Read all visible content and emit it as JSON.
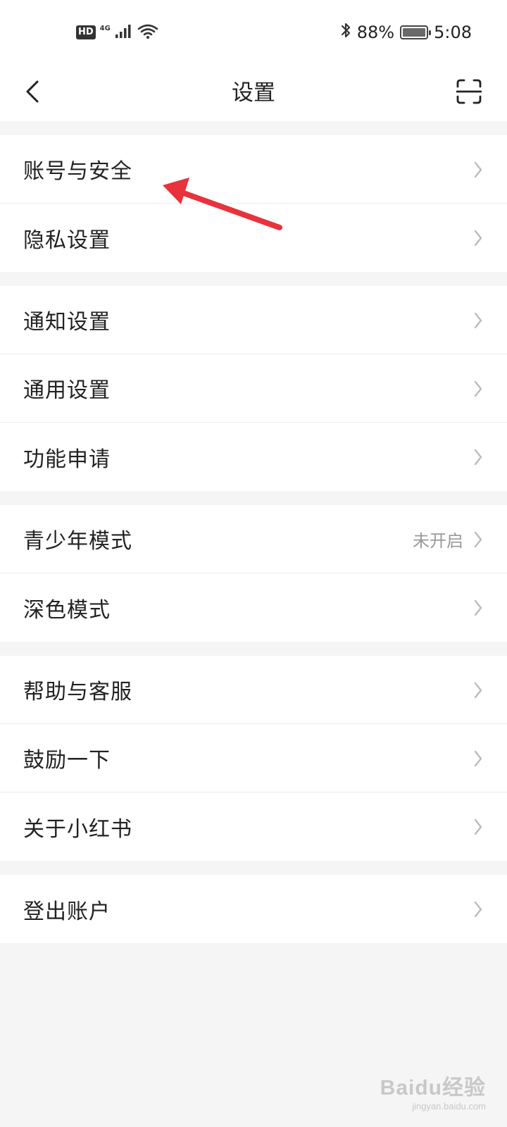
{
  "status_bar": {
    "hd_label": "HD",
    "network_label": "4G",
    "battery_percent": "88%",
    "time": "5:08"
  },
  "nav": {
    "title": "设置"
  },
  "groups": [
    {
      "items": [
        {
          "label": "账号与安全"
        },
        {
          "label": "隐私设置"
        }
      ]
    },
    {
      "items": [
        {
          "label": "通知设置"
        },
        {
          "label": "通用设置"
        },
        {
          "label": "功能申请"
        }
      ]
    },
    {
      "items": [
        {
          "label": "青少年模式",
          "status": "未开启"
        },
        {
          "label": "深色模式"
        }
      ]
    },
    {
      "items": [
        {
          "label": "帮助与客服"
        },
        {
          "label": "鼓励一下"
        },
        {
          "label": "关于小红书"
        }
      ]
    },
    {
      "items": [
        {
          "label": "登出账户"
        }
      ]
    }
  ],
  "annotation": {
    "color": "#e8323c"
  },
  "watermark": {
    "main": "Baidu经验",
    "sub": "jingyan.baidu.com"
  },
  "colors": {
    "background": "#f5f5f5",
    "card": "#ffffff",
    "text": "#222222",
    "secondary_text": "#999999",
    "chevron": "#bbbbbb"
  }
}
